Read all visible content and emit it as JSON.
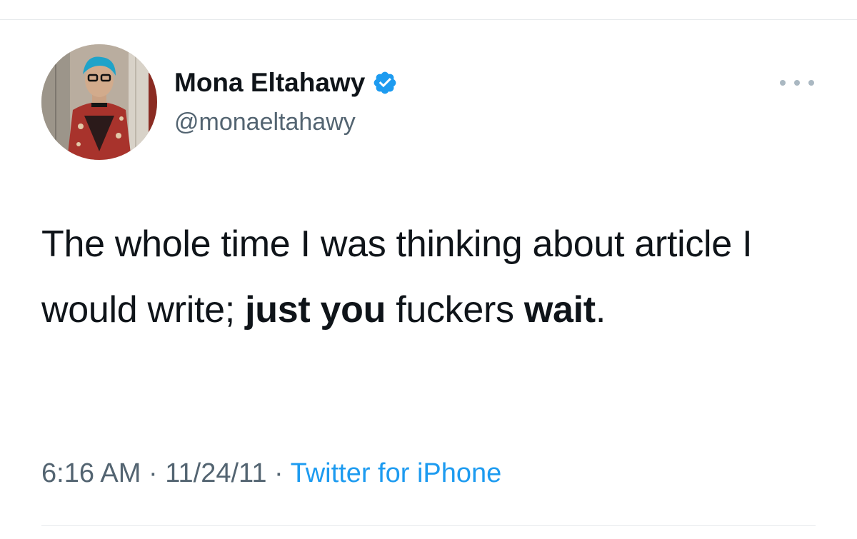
{
  "author": {
    "display_name": "Mona Eltahawy",
    "handle": "@monaeltahawy",
    "verified": true,
    "avatar_icon": "profile-photo"
  },
  "tweet": {
    "segments": [
      {
        "text": "The whole time I was thinking about article I would write; ",
        "bold": false
      },
      {
        "text": "just you",
        "bold": true
      },
      {
        "text": " fuckers ",
        "bold": false
      },
      {
        "text": "wait",
        "bold": true
      },
      {
        "text": ".",
        "bold": false
      }
    ]
  },
  "meta": {
    "time": "6:16 AM",
    "separator": "·",
    "date": "11/24/11",
    "source": "Twitter for iPhone"
  },
  "colors": {
    "text": "#0f1419",
    "secondary": "#536471",
    "link": "#1d9bf0",
    "verified": "#1d9bf0",
    "divider": "#e6e9ec"
  }
}
